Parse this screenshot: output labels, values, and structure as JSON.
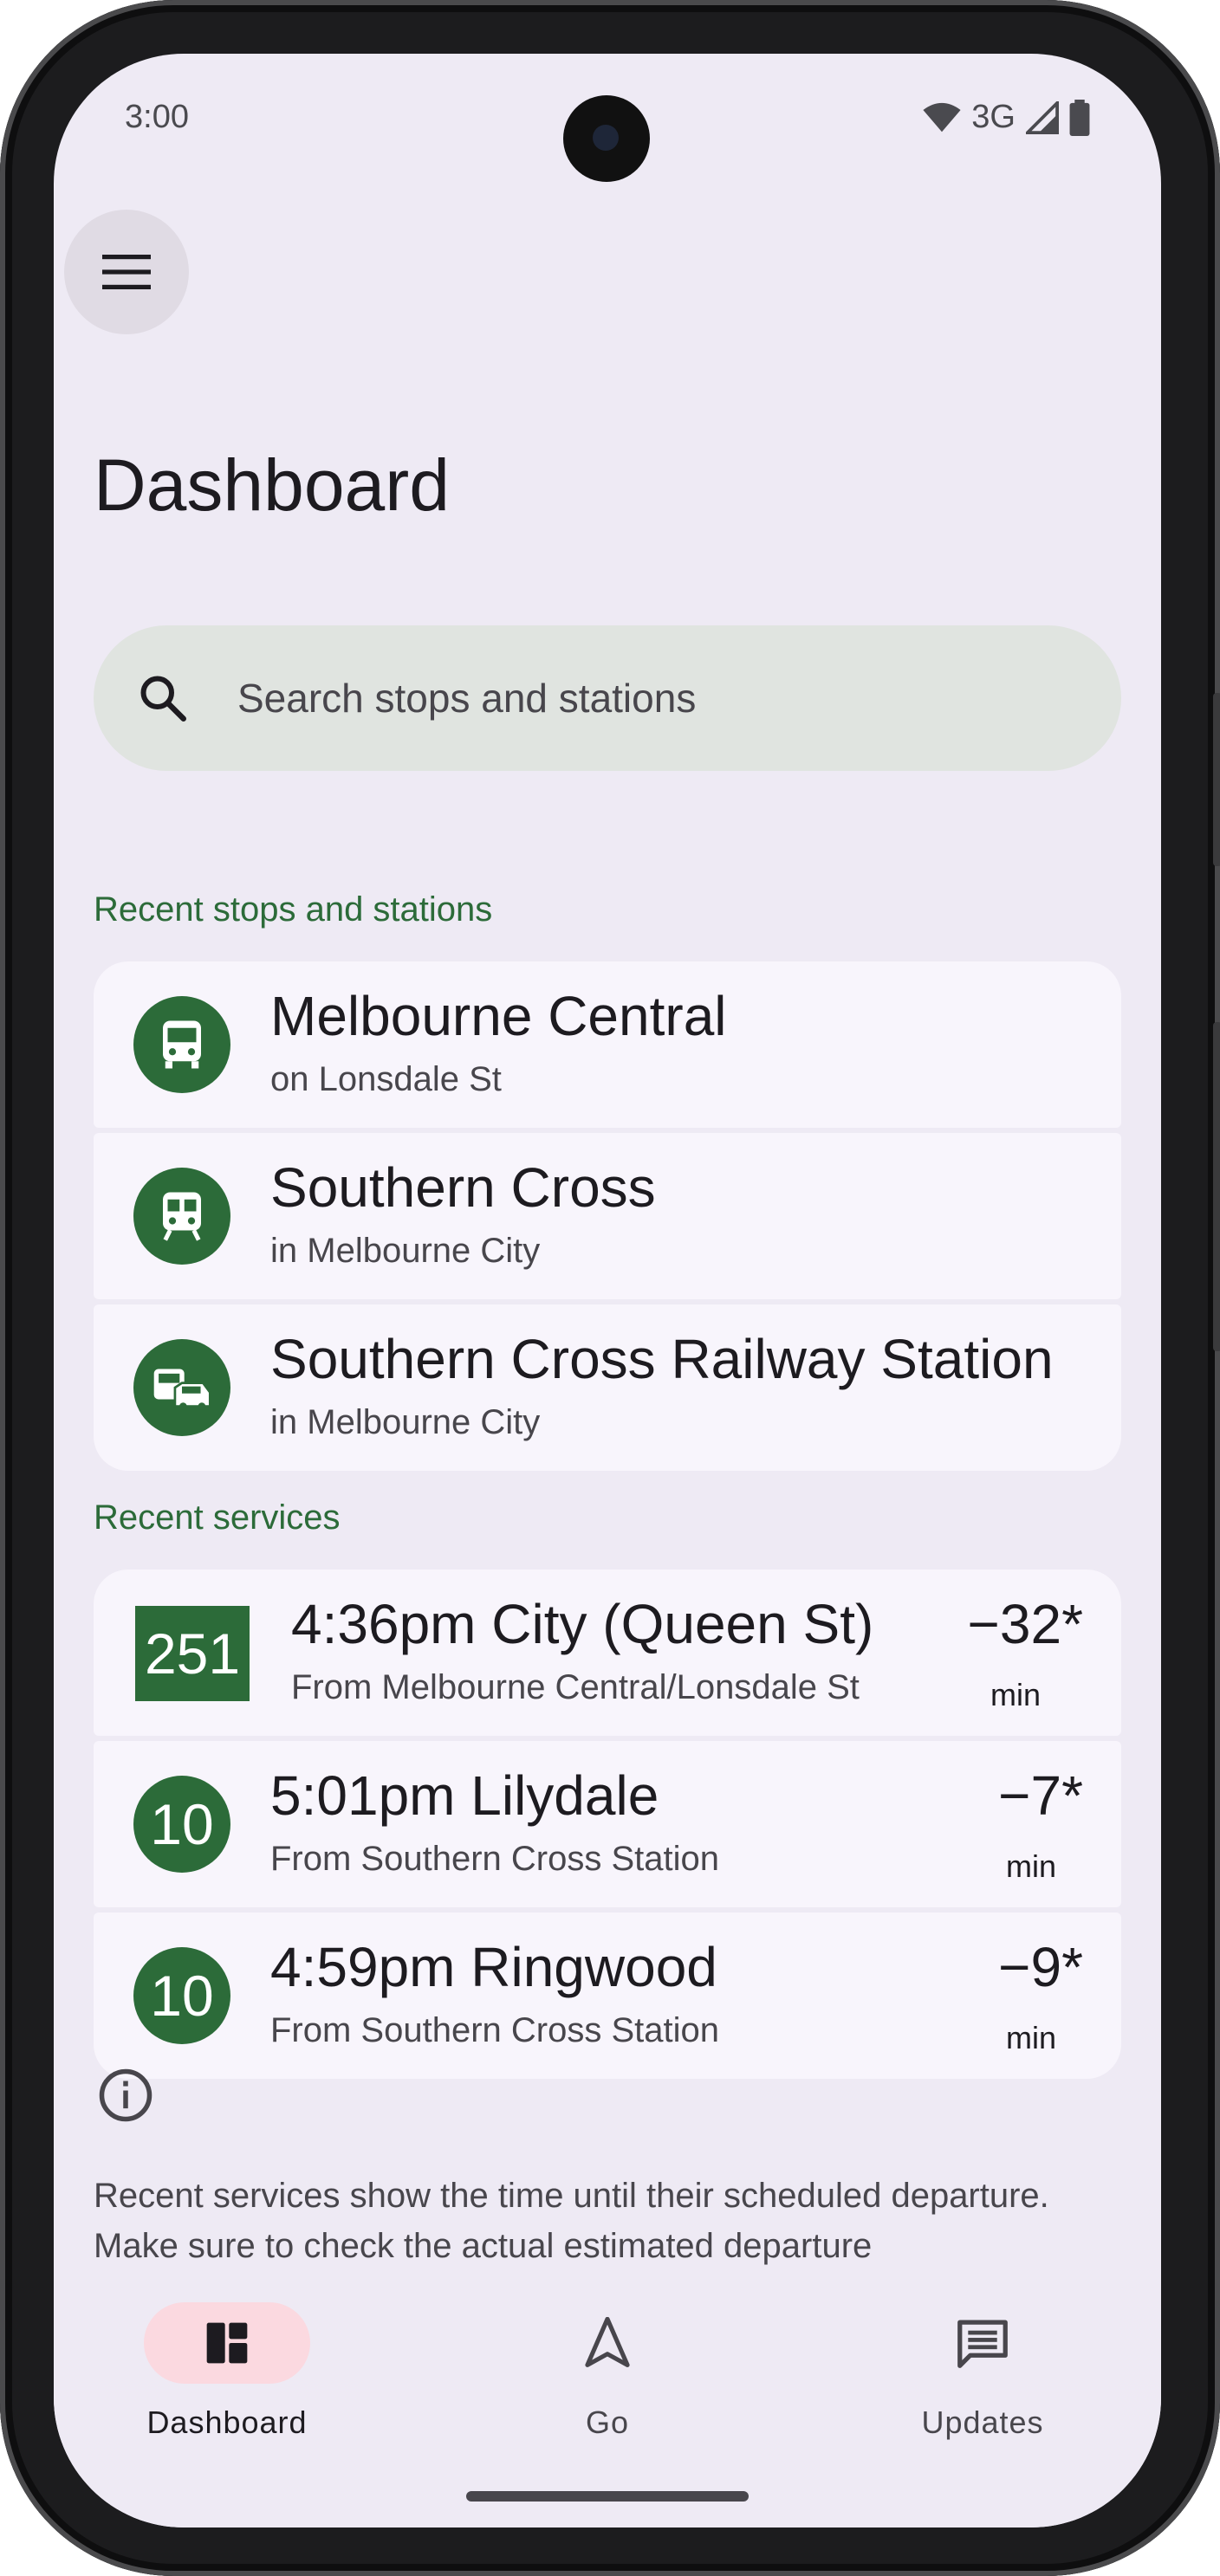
{
  "status_bar": {
    "time": "3:00",
    "network": "3G"
  },
  "header": {
    "title": "Dashboard"
  },
  "search": {
    "placeholder": "Search stops and stations"
  },
  "recent_stops": {
    "label": "Recent stops and stations",
    "items": [
      {
        "name": "Melbourne Central",
        "location": "on Lonsdale St",
        "icon": "bus-icon"
      },
      {
        "name": "Southern Cross",
        "location": "in Melbourne City",
        "icon": "train-icon"
      },
      {
        "name": "Southern Cross Railway Station",
        "location": "in Melbourne City",
        "icon": "coach-car-icon"
      }
    ]
  },
  "recent_services": {
    "label": "Recent services",
    "items": [
      {
        "route": "251",
        "route_shape": "square",
        "title": "4:36pm City (Queen St)",
        "from": "From Melbourne Central/Lonsdale St",
        "delta": "−32*",
        "unit": "min"
      },
      {
        "route": "10",
        "route_shape": "circle",
        "title": "5:01pm Lilydale",
        "from": "From Southern Cross Station",
        "delta": "−7*",
        "unit": "min"
      },
      {
        "route": "10",
        "route_shape": "circle",
        "title": "4:59pm Ringwood",
        "from": "From Southern Cross Station",
        "delta": "−9*",
        "unit": "min"
      }
    ]
  },
  "info": {
    "text": "Recent services show the time until their scheduled departure. Make sure to check the actual estimated departure"
  },
  "nav": {
    "items": [
      {
        "label": "Dashboard",
        "icon": "dashboard-icon",
        "active": true
      },
      {
        "label": "Go",
        "icon": "navigation-arrow-icon",
        "active": false
      },
      {
        "label": "Updates",
        "icon": "message-icon",
        "active": false
      }
    ]
  },
  "colors": {
    "accent": "#2c6b39",
    "background": "#eeeaf4",
    "card": "#f8f5fc",
    "active_pill": "#fbd9e0"
  }
}
